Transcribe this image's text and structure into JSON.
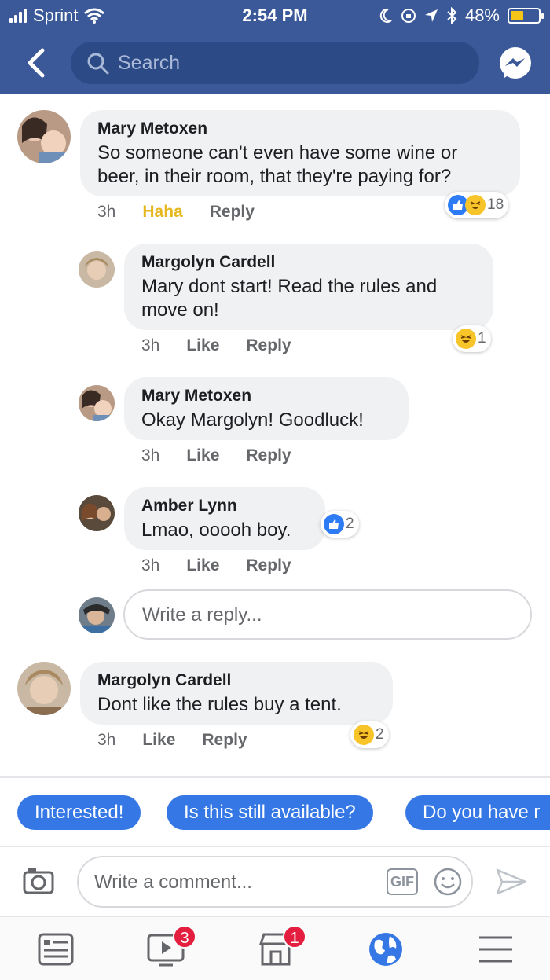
{
  "status_bar": {
    "carrier": "Sprint",
    "time": "2:54 PM",
    "battery_percent": "48%",
    "battery_level": 0.48
  },
  "nav": {
    "search_placeholder": "Search"
  },
  "comments": [
    {
      "author": "Mary Metoxen",
      "text": "So someone can't even have some wine or beer, in their room, that they're paying for?",
      "time": "3h",
      "reaction_label": "Haha",
      "reply_label": "Reply",
      "reaction_count": "18",
      "replies": [
        {
          "author": "Margolyn Cardell",
          "text": "Mary dont start! Read the rules and move on!",
          "time": "3h",
          "like_label": "Like",
          "reply_label": "Reply",
          "reaction_count": "1"
        },
        {
          "author": "Mary Metoxen",
          "text": "Okay Margolyn! Goodluck!",
          "time": "3h",
          "like_label": "Like",
          "reply_label": "Reply"
        },
        {
          "author": "Amber Lynn",
          "text": "Lmao, ooooh boy.",
          "time": "3h",
          "like_label": "Like",
          "reply_label": "Reply",
          "reaction_count": "2"
        }
      ],
      "write_reply_placeholder": "Write a reply..."
    },
    {
      "author": "Margolyn Cardell",
      "text": "Dont like the rules buy a tent.",
      "time": "3h",
      "like_label": "Like",
      "reply_label": "Reply",
      "reaction_count": "2"
    }
  ],
  "quick_replies": [
    "Interested!",
    "Is this still available?",
    "Do you have r"
  ],
  "composer": {
    "placeholder": "Write a comment...",
    "gif_label": "GIF"
  },
  "tab_bar": {
    "watch_badge": "3",
    "marketplace_badge": "1"
  },
  "colors": {
    "brand": "#3b5998",
    "accent": "#3578e5",
    "haha": "#e6b820",
    "badge": "#e41e3f"
  }
}
